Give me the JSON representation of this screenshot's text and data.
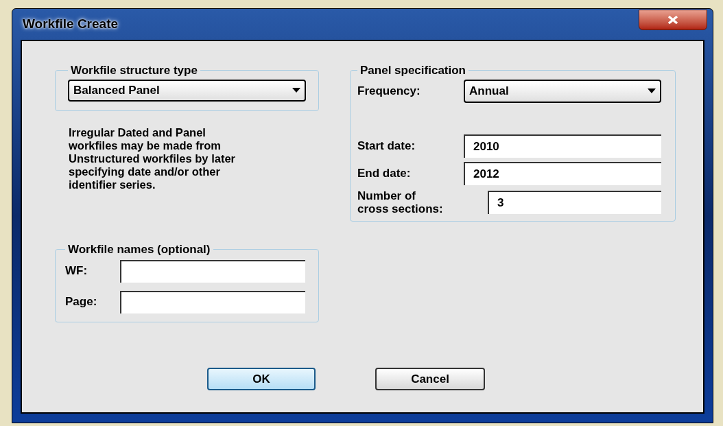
{
  "window": {
    "title": "Workfile Create"
  },
  "structure": {
    "legend": "Workfile structure type",
    "value": "Balanced Panel"
  },
  "note": "Irregular Dated and Panel workfiles may be made from Unstructured workfiles by later specifying date and/or other identifier series.",
  "names": {
    "legend": "Workfile names (optional)",
    "fields": [
      {
        "label": "WF:"
      },
      {
        "label": "Page:"
      }
    ]
  },
  "panel": {
    "legend": "Panel specification",
    "frequency_label": "Frequency:",
    "frequency": "Annual",
    "fields": [
      {
        "label": "Start date:",
        "value": "2010"
      },
      {
        "label": "End date:",
        "value": "2012"
      },
      {
        "label": "Number of cross sections:",
        "value": "3"
      }
    ]
  },
  "buttons": [
    {
      "label": "OK",
      "default": true
    },
    {
      "label": "Cancel",
      "default": false
    }
  ]
}
